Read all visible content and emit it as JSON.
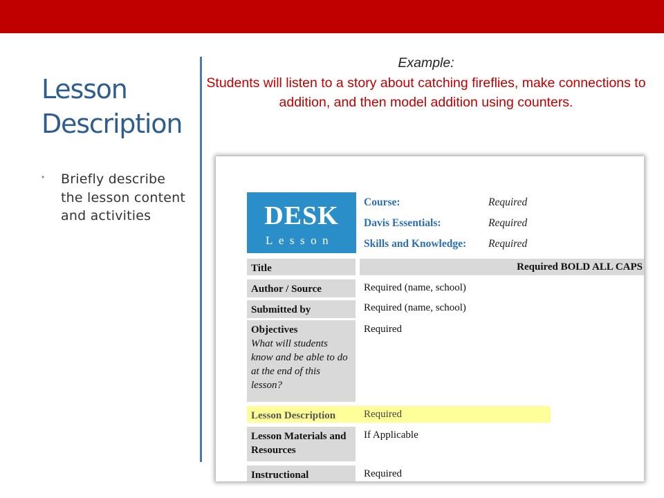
{
  "colors": {
    "top_bar": "#c00000",
    "title": "#2e5d8e",
    "divider": "#4a7bb0",
    "example_text": "#c00000",
    "desk_blue": "#2a8fc8",
    "desk_label": "#2a6fb5",
    "highlight": "#ffff99"
  },
  "slide": {
    "title_line1": "Lesson",
    "title_line2": "Description",
    "bullet": "Briefly describe the lesson content and activities"
  },
  "example": {
    "label": "Example:",
    "text": "Students will listen to a story about catching fireflies, make connections to addition, and then model addition using counters."
  },
  "form": {
    "logo_title": "DESK",
    "logo_subtitle": "Lesson",
    "header": [
      {
        "label": "Course:",
        "value": "Required"
      },
      {
        "label": "Davis Essentials:",
        "value": "Required"
      },
      {
        "label": "Skills and Knowledge:",
        "value": "Required"
      }
    ],
    "title_row": {
      "label": "Title",
      "value": "Required BOLD ALL CAPS"
    },
    "rows": [
      {
        "label": "Author / Source",
        "value": "Required (name, school)"
      },
      {
        "label": "Submitted by",
        "value": "Required (name, school)"
      },
      {
        "label": "Objectives",
        "note": "What will students know and be able to do at the end of this lesson?",
        "value": "Required"
      },
      {
        "label": "Lesson Description",
        "value": "Required"
      },
      {
        "label": "Lesson Materials and Resources",
        "value": "If Applicable"
      },
      {
        "label": "Instructional",
        "value": "Required"
      }
    ]
  }
}
